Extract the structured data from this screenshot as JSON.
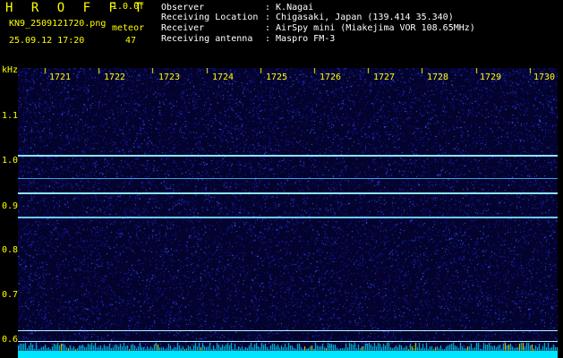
{
  "header": {
    "title": "H R O F F T",
    "version": "1.0.0f",
    "filename": "KN9_2509121720.png",
    "datetime": "25.09.12 17:20",
    "meteor_label": "meteor",
    "meteor_count": "47"
  },
  "info": [
    {
      "label": "Observer",
      "value": ": K.Nagai"
    },
    {
      "label": "Receiving Location",
      "value": ": Chigasaki, Japan (139.414 35.340)"
    },
    {
      "label": "Receiver",
      "value": ": AirSpy mini (Miakejima VOR 108.65MHz)"
    },
    {
      "label": "Receiving antenna",
      "value": ": Maspro FM-3"
    }
  ],
  "axis": {
    "y_unit": "kHz",
    "y_ticks": [
      "1.1",
      "1.0",
      "0.9",
      "0.8",
      "0.7",
      "0.6"
    ],
    "x_ticks": [
      "1721",
      "1722",
      "1723",
      "1724",
      "1725",
      "1726",
      "1727",
      "1728",
      "1729",
      "1730"
    ]
  },
  "colors": {
    "background": "#000000",
    "plot": "#04043a",
    "text_yellow": "#ffff00",
    "text_white": "#ffffff",
    "signal": "#6fd8ff",
    "baseline": "#00e5ff"
  }
}
